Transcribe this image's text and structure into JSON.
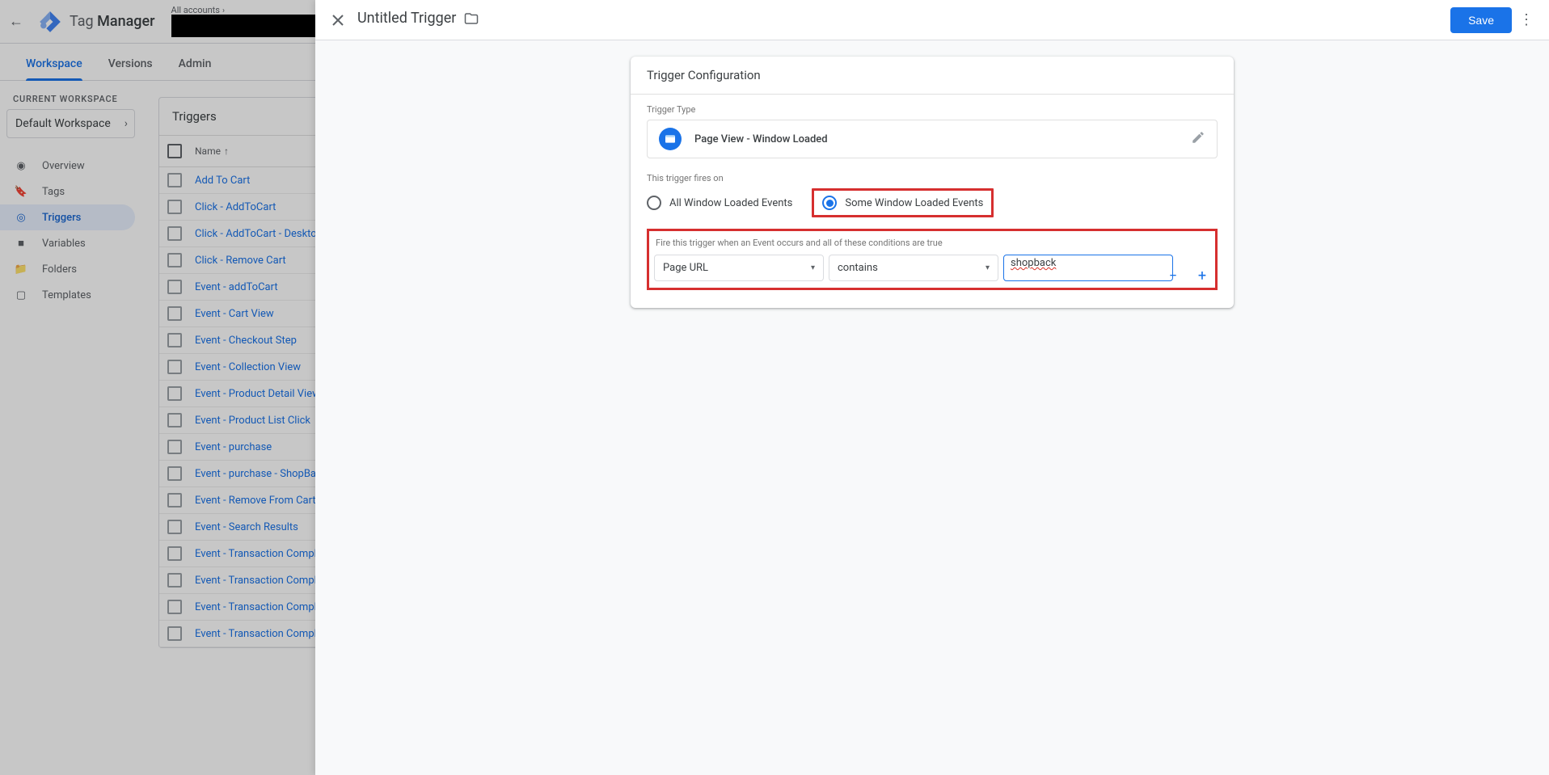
{
  "header": {
    "brand_left": "Tag ",
    "brand_right": "Manager",
    "breadcrumb_prefix": "All accounts"
  },
  "nav_tabs": {
    "workspace": "Workspace",
    "versions": "Versions",
    "admin": "Admin"
  },
  "workspace": {
    "label": "CURRENT WORKSPACE",
    "name": "Default Workspace"
  },
  "sidebar": {
    "overview": "Overview",
    "tags": "Tags",
    "triggers": "Triggers",
    "variables": "Variables",
    "folders": "Folders",
    "templates": "Templates"
  },
  "list": {
    "title": "Triggers",
    "col_name": "Name",
    "rows": [
      "Add To Cart",
      "Click - AddToCart",
      "Click - AddToCart - Desktop",
      "Click - Remove Cart",
      "Event - addToCart",
      "Event - Cart View",
      "Event - Checkout Step",
      "Event - Collection View",
      "Event - Product Detail View",
      "Event - Product List Click",
      "Event - purchase",
      "Event - purchase - ShopBack",
      "Event - Remove From Cart",
      "Event - Search Results",
      "Event - Transaction Complet",
      "Event - Transaction Complet",
      "Event - Transaction Complet",
      "Event - Transaction Complet"
    ]
  },
  "drawer": {
    "title": "Untitled Trigger",
    "save": "Save",
    "card_title": "Trigger Configuration",
    "type_label": "Trigger Type",
    "type_name": "Page View - Window Loaded",
    "fires_label": "This trigger fires on",
    "opt_all": "All Window Loaded Events",
    "opt_some": "Some Window Loaded Events",
    "cond_label": "Fire this trigger when an Event occurs and all of these conditions are true",
    "var": "Page URL",
    "operator": "contains",
    "value": "shopback"
  }
}
